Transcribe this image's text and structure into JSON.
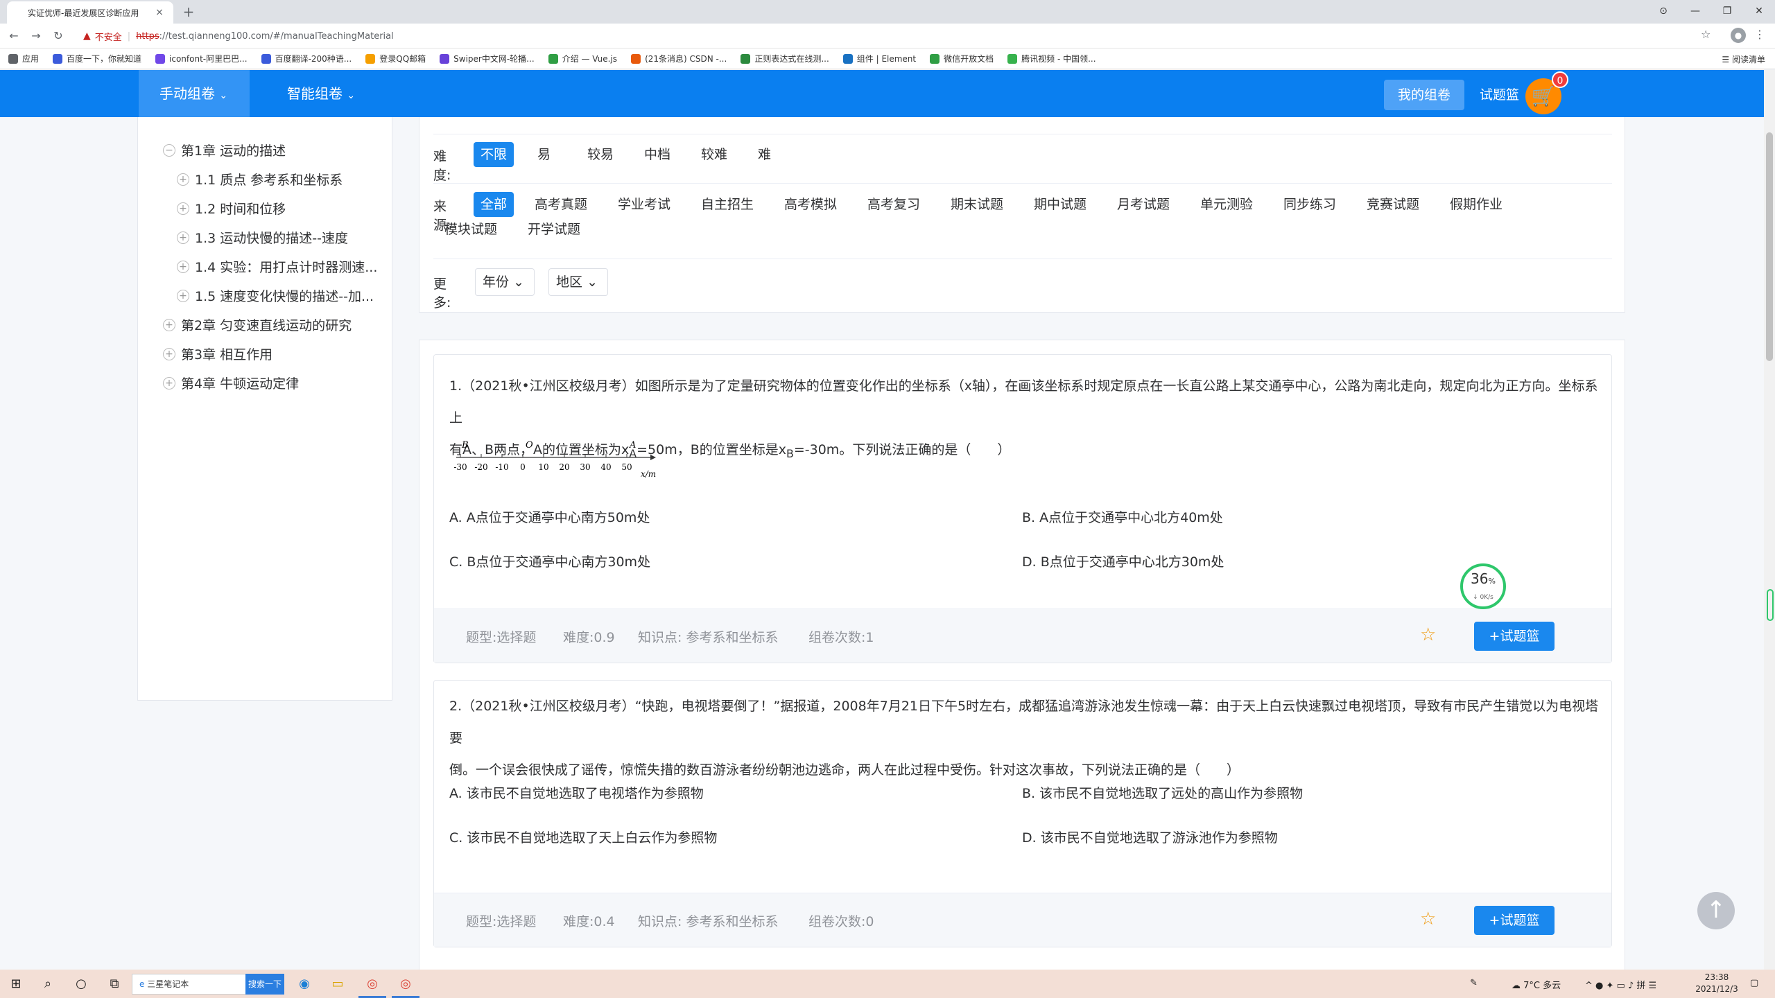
{
  "browser": {
    "tab_title": "实证优师-最近发展区诊断应用",
    "tab_close": "×",
    "newtab": "+",
    "not_secure": "不安全",
    "url_scheme": "https",
    "url_rest": "://test.qianneng100.com/#/manualTeachingMaterial",
    "bookmarks": [
      {
        "label": "应用",
        "color": "#5f6368"
      },
      {
        "label": "百度一下，你就知道",
        "color": "#3b5bdb"
      },
      {
        "label": "iconfont-阿里巴巴...",
        "color": "#7048e8"
      },
      {
        "label": "百度翻译-200种语...",
        "color": "#3b5bdb"
      },
      {
        "label": "登录QQ邮箱",
        "color": "#f59f00"
      },
      {
        "label": "Swiper中文网-轮播...",
        "color": "#6741d9"
      },
      {
        "label": "介绍 — Vue.js",
        "color": "#2f9e44"
      },
      {
        "label": "(21条消息) CSDN -...",
        "color": "#e8590c"
      },
      {
        "label": "正则表达式在线测...",
        "color": "#2b8a3e"
      },
      {
        "label": "组件 | Element",
        "color": "#1971c2"
      },
      {
        "label": "微信开放文档",
        "color": "#2f9e44"
      },
      {
        "label": "腾讯视频 - 中国领...",
        "color": "#37b24d"
      }
    ],
    "reading_list": "阅读清单"
  },
  "nav": {
    "manual": "手动组卷",
    "smart": "智能组卷",
    "my_papers": "我的组卷",
    "basket": "试题篮",
    "cart_count": "0"
  },
  "tree": {
    "chapters": [
      {
        "label": "第1章 运动的描述",
        "toggle": "−"
      },
      {
        "label": "1.1 质点 参考系和坐标系",
        "toggle": "+"
      },
      {
        "label": "1.2 时间和位移",
        "toggle": "+"
      },
      {
        "label": "1.3 运动快慢的描述--速度",
        "toggle": "+"
      },
      {
        "label": "1.4 实验：用打点计时器测速...",
        "toggle": "+"
      },
      {
        "label": "1.5 速度变化快慢的描述--加...",
        "toggle": "+"
      },
      {
        "label": "第2章 匀变速直线运动的研究",
        "toggle": "+"
      },
      {
        "label": "第3章 相互作用",
        "toggle": "+"
      },
      {
        "label": "第4章 牛顿运动定律",
        "toggle": "+"
      }
    ]
  },
  "filters": {
    "difficulty_label": "难度:",
    "difficulty": [
      "不限",
      "易",
      "较易",
      "中档",
      "较难",
      "难"
    ],
    "source_label": "来源:",
    "sources": [
      "全部",
      "高考真题",
      "学业考试",
      "自主招生",
      "高考模拟",
      "高考复习",
      "期末试题",
      "期中试题",
      "月考试题",
      "单元测验",
      "同步练习",
      "竞赛试题",
      "假期作业",
      "模块试题",
      "开学试题"
    ],
    "more_label": "更多:",
    "year": "年份",
    "region": "地区"
  },
  "questions": [
    {
      "stem_a": "1.（2021秋•江州区校级月考）如图所示是为了定量研究物体的位置变化作出的坐标系（x轴），在画该坐标系时规定原点在一长直公路上某交通亭中心，公路为南北走向，规定向北为正方向。坐标系上",
      "stem_b1": "有A、B两点，A的位置坐标为x",
      "stem_sub_a": "A",
      "stem_b2": "=50m，B的位置坐标是x",
      "stem_sub_b": "B",
      "stem_b3": "=-30m。下列说法正确的是（　　）",
      "axis": {
        "labels_top": [
          "B",
          "O",
          "A"
        ],
        "ticks": [
          "-30",
          "-20",
          "-10",
          "0",
          "10",
          "20",
          "30",
          "40",
          "50"
        ],
        "unit": "x/m"
      },
      "options": [
        "A.  A点位于交通亭中心南方50m处",
        "B.  A点位于交通亭中心北方40m处",
        "C.  B点位于交通亭中心南方30m处",
        "D.  B点位于交通亭中心北方30m处"
      ],
      "meta": {
        "type": "题型:选择题",
        "difficulty": "难度:0.9",
        "knowledge": "知识点:  参考系和坐标系",
        "count": "组卷次数:1"
      },
      "add": "+试题篮"
    },
    {
      "stem_a": "2.（2021秋•江州区校级月考）“快跑，电视塔要倒了！”据报道，2008年7月21日下午5时左右，成都猛追湾游泳池发生惊魂一幕：由于天上白云快速飘过电视塔顶，导致有市民产生错觉以为电视塔要",
      "stem_b": "倒。一个误会很快成了谣传，惊慌失措的数百游泳者纷纷朝池边逃命，两人在此过程中受伤。针对这次事故，下列说法正确的是（　　）",
      "options": [
        "A.  该市民不自觉地选取了电视塔作为参照物",
        "B.  该市民不自觉地选取了远处的高山作为参照物",
        "C.  该市民不自觉地选取了天上白云作为参照物",
        "D.  该市民不自觉地选取了游泳池作为参照物"
      ],
      "meta": {
        "type": "题型:选择题",
        "difficulty": "难度:0.4",
        "knowledge": "知识点:  参考系和坐标系",
        "count": "组卷次数:0"
      },
      "add": "+试题篮"
    }
  ],
  "speed_widget": {
    "percent": "36",
    "percent_sign": "%",
    "rate": "↓ 0K/s"
  },
  "backtop": "↑",
  "taskbar": {
    "search_text": "三星笔记本",
    "search_btn": "搜索一下",
    "weather": "7°C 多云",
    "time": "23:38",
    "date": "2021/12/3"
  },
  "colors": {
    "primary": "#0a7ff0",
    "accent": "#1a88ee",
    "cart": "#ff8a00",
    "badge": "#f03c3c",
    "star": "#f0a020"
  }
}
